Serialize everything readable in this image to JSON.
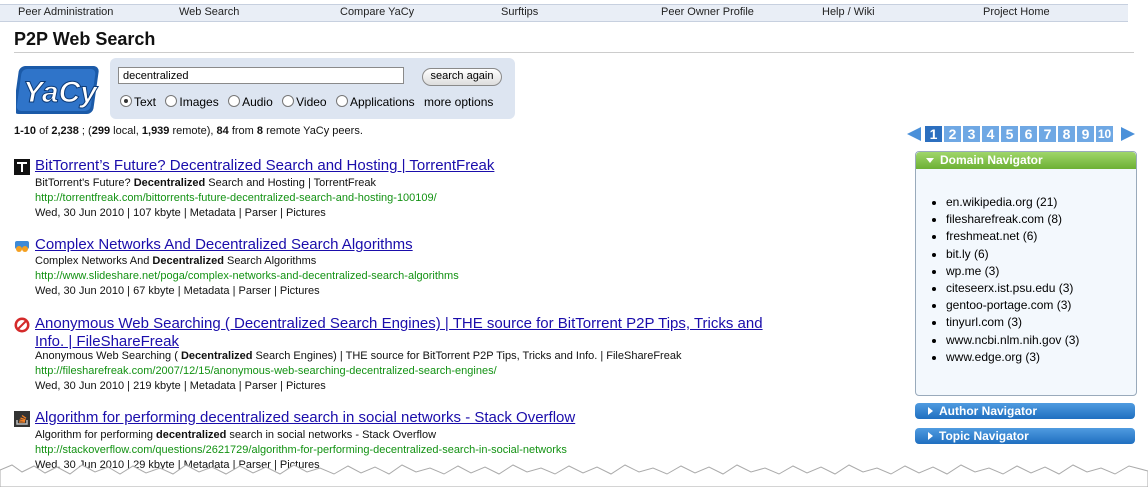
{
  "nav": [
    "Peer Administration",
    "Web Search",
    "Compare YaCy",
    "Surftips",
    "Peer Owner Profile",
    "Help / Wiki",
    "Project Home"
  ],
  "page_title": "P2P Web Search",
  "logo_text": "YaCy",
  "search": {
    "query": "decentralized",
    "button": "search again"
  },
  "content_types": [
    {
      "label": "Text",
      "selected": true
    },
    {
      "label": "Images",
      "selected": false
    },
    {
      "label": "Audio",
      "selected": false
    },
    {
      "label": "Video",
      "selected": false
    },
    {
      "label": "Applications",
      "selected": false
    }
  ],
  "more_options": "more options",
  "stats": {
    "range": "1-10",
    "of": "of",
    "total": "2,238",
    "local": "299",
    "local_label": "local",
    "remote": "1,939",
    "remote_label": "remote",
    "from_count": "84",
    "from_label": "from",
    "peers": "8",
    "peers_label": "remote YaCy peers."
  },
  "pages": [
    "1",
    "2",
    "3",
    "4",
    "5",
    "6",
    "7",
    "8",
    "9",
    "10"
  ],
  "current_page": "1",
  "results": [
    {
      "icon": "torrentfreak-favicon",
      "title": "BitTorrent’s Future? Decentralized Search and Hosting | TorrentFreak",
      "desc_pre": "BitTorrent's Future? ",
      "desc_bold": "Decentralized",
      "desc_post": " Search and Hosting | TorrentFreak",
      "url": "http://torrentfreak.com/bittorrents-future-decentralized-search-and-hosting-100109/",
      "date": "Wed, 30 Jun 2010",
      "size": "107 kbyte"
    },
    {
      "icon": "slideshare-favicon",
      "title": "Complex Networks And Decentralized Search Algorithms",
      "desc_pre": "Complex Networks And ",
      "desc_bold": "Decentralized",
      "desc_post": " Search Algorithms",
      "url": "http://www.slideshare.net/poga/complex-networks-and-decentralized-search-algorithms",
      "date": "Wed, 30 Jun 2010",
      "size": "67 kbyte"
    },
    {
      "icon": "filesharefreak-favicon",
      "title": "Anonymous Web Searching ( Decentralized Search Engines) | THE source for BitTorrent P2P Tips, Tricks and Info. | FileShareFreak",
      "desc_pre": "Anonymous Web Searching ( ",
      "desc_bold": "Decentralized",
      "desc_post": " Search Engines) | THE source for BitTorrent P2P Tips, Tricks and Info. | FileShareFreak",
      "url": "http://filesharefreak.com/2007/12/15/anonymous-web-searching-decentralized-search-engines/",
      "date": "Wed, 30 Jun 2010",
      "size": "219 kbyte"
    },
    {
      "icon": "stackoverflow-favicon",
      "title": "Algorithm for performing decentralized search in social networks - Stack Overflow",
      "desc_pre": "Algorithm for performing ",
      "desc_bold": "decentralized",
      "desc_post": " search in social networks - Stack Overflow",
      "url": "http://stackoverflow.com/questions/2621729/algorithm-for-performing-decentralized-search-in-social-networks",
      "date": "Wed, 30 Jun 2010",
      "size": "29 kbyte"
    }
  ],
  "meta_links": {
    "metadata": "Metadata",
    "parser": "Parser",
    "pictures": "Pictures",
    "sep": "|"
  },
  "domain_navigator": {
    "title": "Domain Navigator",
    "items": [
      "en.wikipedia.org (21)",
      "filesharefreak.com (8)",
      "freshmeat.net (6)",
      "bit.ly (6)",
      "wp.me (3)",
      "citeseerx.ist.psu.edu (3)",
      "gentoo-portage.com (3)",
      "tinyurl.com (3)",
      "www.ncbi.nlm.nih.gov (3)",
      "www.edge.org (3)"
    ]
  },
  "author_navigator": "Author Navigator",
  "topic_navigator": "Topic Navigator",
  "colors": {
    "link": "#1a0dab",
    "url": "#139213",
    "pager": "#6fa8e4",
    "domain_head": "#6cb034",
    "nav_blue": "#1f6fc0"
  }
}
